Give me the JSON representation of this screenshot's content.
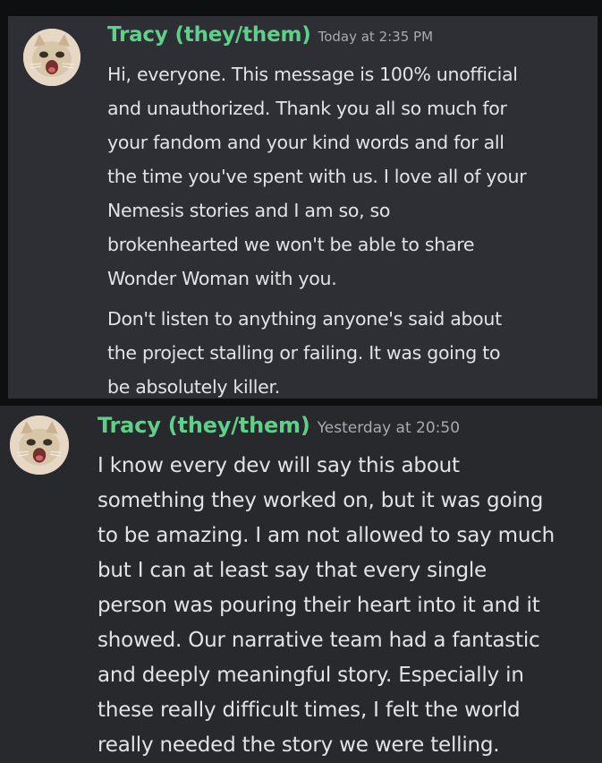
{
  "messages": [
    {
      "username": "Tracy (they/them)",
      "timestamp": "Today at 2:35 PM",
      "paragraphs": [
        {
          "lines": [
            "Hi, everyone. This message is 100% unofficial",
            "and unauthorized. Thank you all so much for",
            "your fandom and your kind words and for all",
            "the time you've spent with us. I love all of your",
            "Nemesis stories and I am so, so",
            "brokenhearted we won't be able to share",
            "Wonder Woman with you."
          ]
        },
        {
          "lines": [
            "Don't listen to anything anyone's said about",
            "the project stalling or failing. It was going to",
            "be absolutely killer."
          ]
        }
      ]
    },
    {
      "username": "Tracy (they/them)",
      "timestamp": "Yesterday at 20:50",
      "paragraphs": [
        {
          "lines": [
            "I know every dev will say this about",
            "something they worked on, but it was going",
            "to be amazing. I am not allowed to say much",
            "but I can at least say that every single",
            "person was pouring their heart into it and it",
            "showed. Our narrative team had a fantastic",
            "and deeply meaningful story. Especially in",
            "these really difficult times, I felt the world",
            "really needed the story we were telling."
          ]
        }
      ]
    }
  ],
  "colors": {
    "username": "#5fcf8a",
    "timestamp": "#a8abb2",
    "body_text": "#e1e3e6",
    "message_bg": "#2d2f34",
    "page_bg": "#0e0f11"
  },
  "icons": {
    "avatar": "cat-avatar-icon"
  }
}
